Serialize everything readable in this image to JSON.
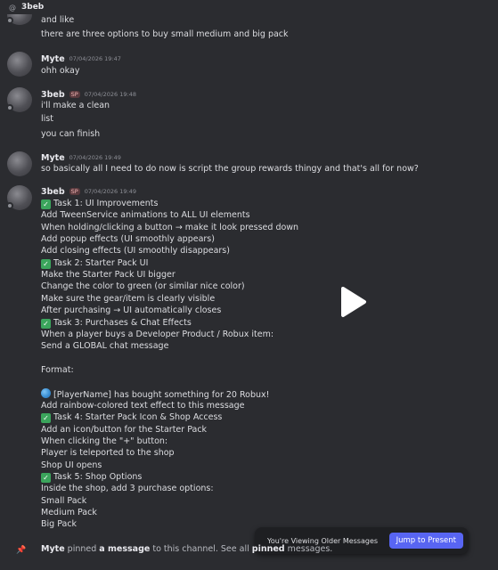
{
  "channel": {
    "title": "3beb"
  },
  "messages": [
    {
      "lines": [
        "and like",
        "there are three options to buy small medium and big pack"
      ]
    },
    {
      "user": "Myte",
      "time": "07/04/2026 19:47",
      "lines": [
        "ohh okay"
      ]
    },
    {
      "user": "3beb",
      "badge": "SP",
      "time": "07/04/2026 19:48",
      "lines": [
        "i'll make a clean",
        "list",
        "you can finish"
      ]
    },
    {
      "user": "Myte",
      "time": "07/04/2026 19:49",
      "lines": [
        "so basically all I need to do now is script the group rewards thingy and that's all for now?"
      ]
    },
    {
      "user": "3beb",
      "badge": "SP",
      "time": "07/04/2026 19:49",
      "lines": [
        "Task 1: UI Improvements",
        "Add TweenService animations to ALL UI elements",
        "When holding/clicking a button → make it look pressed down",
        "Add popup effects (UI smoothly appears)",
        "Add closing effects (UI smoothly disappears)",
        "Task 2: Starter Pack UI",
        "Make the Starter Pack UI bigger",
        "Change the color to green (or similar nice color)",
        "Make sure the gear/item is clearly visible",
        "After purchasing → UI automatically closes",
        "Task 3: Purchases & Chat Effects",
        "When a player buys a Developer Product / Robux item:",
        "Send a GLOBAL chat message",
        "",
        "Format:",
        "",
        "[PlayerName] has bought something for 20 Robux!",
        "Add rainbow-colored text effect to this message",
        "Task 4: Starter Pack Icon & Shop Access",
        "Add an icon/button for the Starter Pack",
        "When clicking the \"+\" button:",
        "Player is teleported to the shop",
        "Shop UI opens",
        "Task 5: Shop Options",
        "Inside the shop, add 3 purchase options:",
        "Small Pack",
        "Medium Pack",
        "Big Pack"
      ]
    }
  ],
  "pin": {
    "user": "Myte",
    "t1": "pinned",
    "t2": "a message",
    "t3": "to this channel. See all",
    "t4": "pinned",
    "t5": "messages."
  },
  "older_banner": {
    "label": "You're Viewing Older Messages",
    "button": "Jump to Present"
  },
  "colors": {
    "accent": "#5865f2",
    "check": "#3ba55c",
    "background": "#2b2c30"
  }
}
